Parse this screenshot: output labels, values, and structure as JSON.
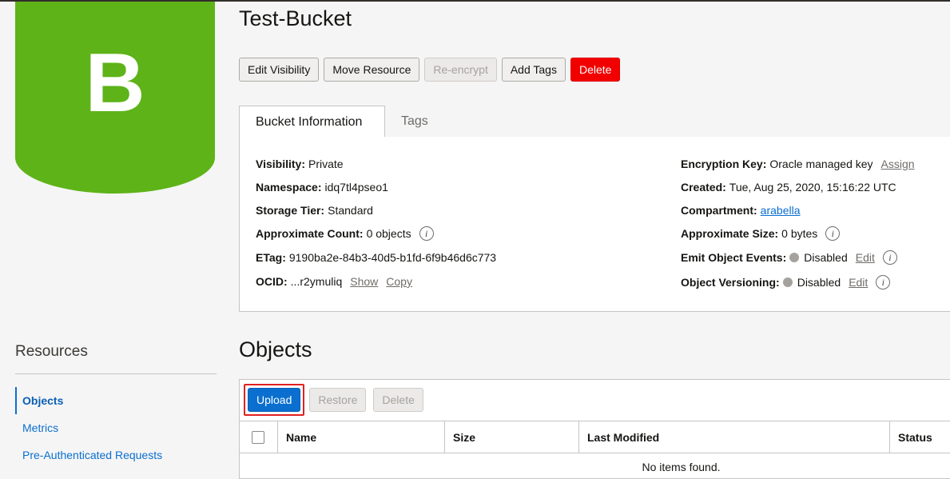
{
  "bucket": {
    "logo_letter": "B",
    "title": "Test-Bucket"
  },
  "actions": {
    "edit_visibility": "Edit Visibility",
    "move_resource": "Move Resource",
    "re_encrypt": "Re-encrypt",
    "add_tags": "Add Tags",
    "delete": "Delete"
  },
  "tabs": {
    "bucket_information": "Bucket Information",
    "tags": "Tags"
  },
  "info": {
    "visibility": {
      "label": "Visibility:",
      "value": "Private"
    },
    "namespace": {
      "label": "Namespace:",
      "value": "idq7tl4pseo1"
    },
    "storage_tier": {
      "label": "Storage Tier:",
      "value": "Standard"
    },
    "approx_count": {
      "label": "Approximate Count:",
      "value": "0 objects"
    },
    "etag": {
      "label": "ETag:",
      "value": "9190ba2e-84b3-40d5-b1fd-6f9b46d6c773"
    },
    "ocid": {
      "label": "OCID:",
      "value": "...r2ymuliq",
      "show": "Show",
      "copy": "Copy"
    },
    "encryption_key": {
      "label": "Encryption Key:",
      "value": "Oracle managed key",
      "action": "Assign"
    },
    "created": {
      "label": "Created:",
      "value": "Tue, Aug 25, 2020, 15:16:22 UTC"
    },
    "compartment": {
      "label": "Compartment:",
      "value": "arabella"
    },
    "approx_size": {
      "label": "Approximate Size:",
      "value": "0 bytes"
    },
    "emit_events": {
      "label": "Emit Object Events:",
      "value": "Disabled",
      "action": "Edit"
    },
    "versioning": {
      "label": "Object Versioning:",
      "value": "Disabled",
      "action": "Edit"
    },
    "info_glyph": "i"
  },
  "sidebar": {
    "heading": "Resources",
    "items": [
      {
        "label": "Objects",
        "active": true
      },
      {
        "label": "Metrics",
        "active": false
      },
      {
        "label": "Pre-Authenticated Requests",
        "active": false
      }
    ]
  },
  "objects": {
    "heading": "Objects",
    "upload": "Upload",
    "restore": "Restore",
    "delete": "Delete",
    "columns": [
      "Name",
      "Size",
      "Last Modified",
      "Status"
    ],
    "empty_message": "No items found."
  },
  "colors": {
    "bucket_green": "#5eb318",
    "delete_red": "#f20000",
    "primary_blue": "#0a6fcf",
    "highlight_red": "#e02020"
  },
  "icons": {
    "info": "info-icon",
    "status_dot": "status-dot-icon",
    "checkbox": "select-all-checkbox"
  }
}
